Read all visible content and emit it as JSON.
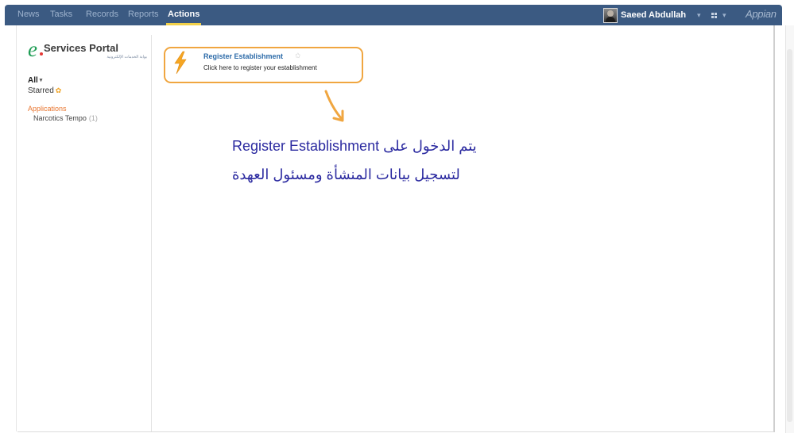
{
  "nav": {
    "items": [
      {
        "label": "News",
        "active": false
      },
      {
        "label": "Tasks",
        "active": false
      },
      {
        "label": "Records",
        "active": false
      },
      {
        "label": "Reports",
        "active": false
      },
      {
        "label": "Actions",
        "active": true
      }
    ],
    "user_name": "Saeed Abdullah",
    "user_caret": "▾",
    "apps_caret": "▾",
    "brand": "Appian"
  },
  "logo": {
    "letter": "e",
    "title": "Services Portal",
    "subtitle": "بوابة الخدمات الإلكترونية"
  },
  "sidebar": {
    "filter_all": "All",
    "filter_all_caret": "▾",
    "filter_starred": "Starred",
    "applications_heading": "Applications",
    "applications": [
      {
        "name": "Narcotics Tempo",
        "count": "(1)"
      }
    ]
  },
  "action": {
    "title": "Register Establishment",
    "description": "Click here to register your establishment",
    "icon": "lightning-bolt-icon",
    "star_icon": "star-outline-icon"
  },
  "annotation": {
    "line1_arabic_prefix": "يتم الدخول على",
    "line1_english": "Register Establishment",
    "line2": "لتسجيل بيانات المنشأة ومسئول العهدة"
  },
  "colors": {
    "nav_bg": "#3b5a82",
    "active_underline": "#f2d14a",
    "highlight_border": "#f0a640",
    "annotation_text": "#2b2aa0",
    "link_blue": "#2b6aa8",
    "logo_green": "#1f9d55",
    "applications_orange": "#e8752f"
  }
}
